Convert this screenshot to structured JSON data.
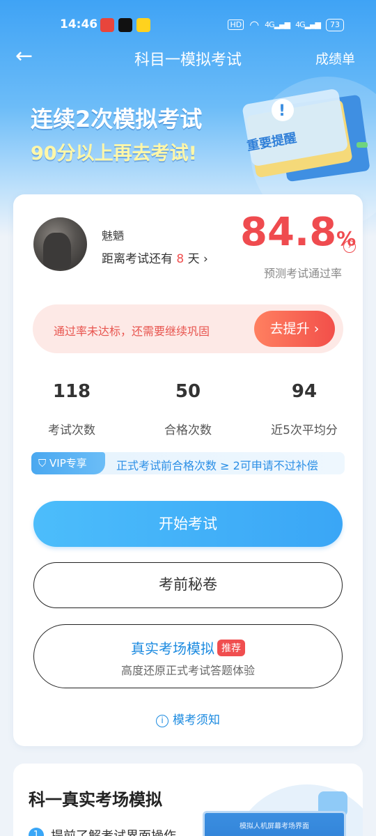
{
  "status_bar": {
    "time": "14:46",
    "hd": "HD",
    "net1": "4G",
    "net2": "4G",
    "battery": "73",
    "app_icons": [
      "toutiao-app-icon",
      "douyin-app-icon",
      "game-app-icon"
    ]
  },
  "nav": {
    "title": "科目一模拟考试",
    "right": "成绩单"
  },
  "banner": {
    "line1": "连续2次模拟考试",
    "line2": "90分以上再去考试!",
    "art_label": "重要提醒"
  },
  "profile": {
    "name": "魅魉",
    "countdown_prefix": "距离考试还有",
    "countdown_days": "8",
    "countdown_suffix": "天",
    "pass_rate": "84.8",
    "pass_rate_unit": "%",
    "pass_rate_label": "预测考试通过率"
  },
  "alert": {
    "text": "通过率未达标，还需要继续巩固",
    "button": "去提升"
  },
  "stats": [
    {
      "value": "118",
      "label": "考试次数"
    },
    {
      "value": "50",
      "label": "合格次数"
    },
    {
      "value": "94",
      "label": "近5次平均分"
    }
  ],
  "vip": {
    "tag": "VIP专享",
    "text": "正式考试前合格次数 ≥ 2可申请不过补偿"
  },
  "buttons": {
    "start": "开始考试",
    "secret": "考前秘卷",
    "sim_title": "真实考场模拟",
    "sim_badge": "推荐",
    "sim_sub": "高度还原正式考试答题体验",
    "notice": "模考须知"
  },
  "section2": {
    "title": "科一真实考场模拟",
    "step1_num": "1",
    "step1_text": "提前了解考试界面操作"
  },
  "colors": {
    "accent_blue": "#3aa6f6",
    "alert_red": "#ef4b4f"
  }
}
